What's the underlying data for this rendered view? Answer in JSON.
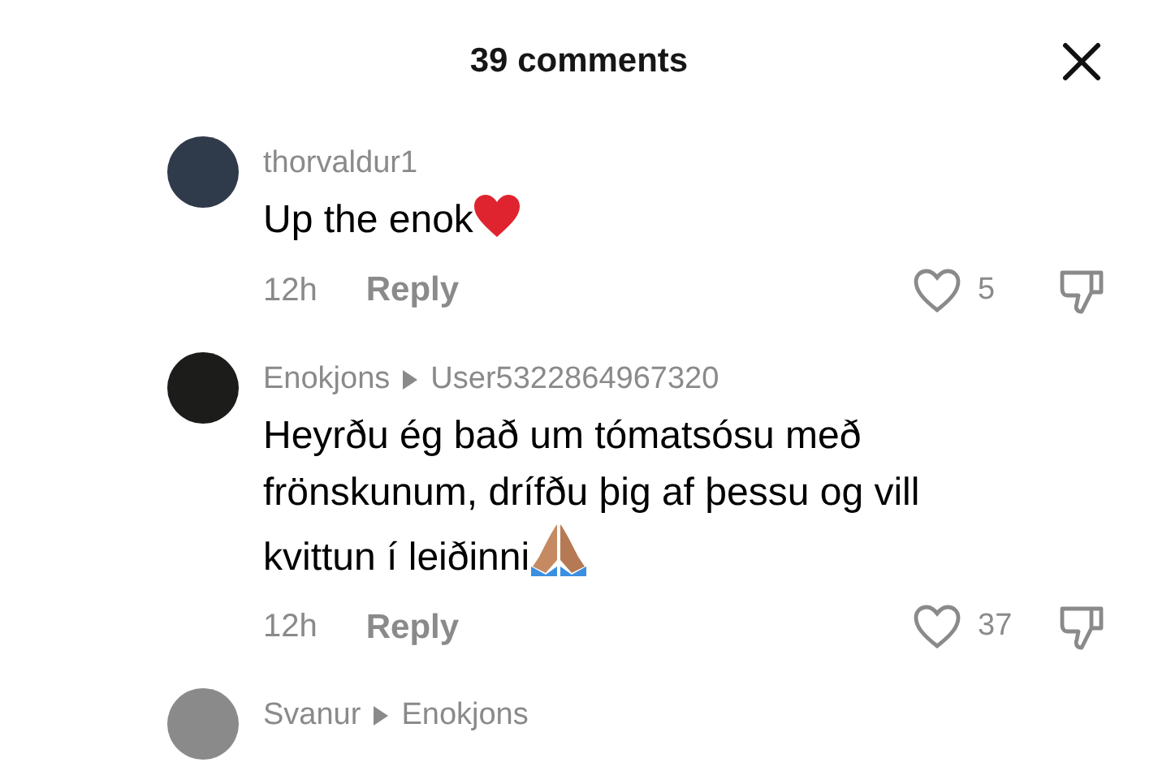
{
  "header": {
    "title": "39 comments"
  },
  "comments": [
    {
      "user": "thorvaldur1",
      "text": "Up the enok",
      "emoji": {
        "kind": "heart"
      },
      "time": "12h",
      "reply_label": "Reply",
      "likes": "5",
      "liked": false
    },
    {
      "user": "Enokjons",
      "reply_to": "User5322864967320",
      "text": "Heyrðu ég bað um tómatsósu með frönskunum, drífðu þig af þessu og vill kvittun í leiðinni",
      "emoji": {
        "kind": "praying"
      },
      "time": "12h",
      "reply_label": "Reply",
      "likes": "37",
      "liked": false
    },
    {
      "user": "Svanur",
      "reply_to": "Enokjons"
    }
  ]
}
